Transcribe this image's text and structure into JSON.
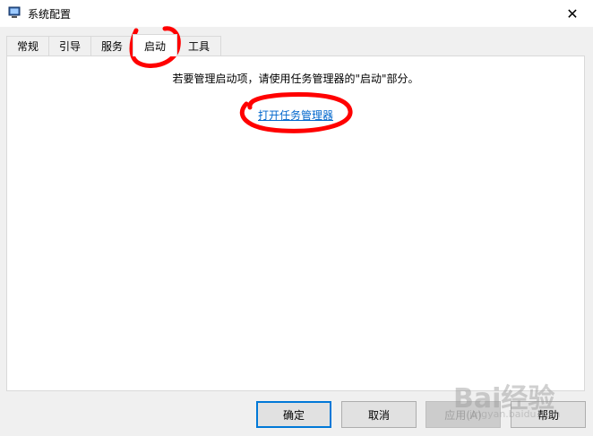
{
  "window": {
    "title": "系统配置",
    "close_glyph": "✕"
  },
  "tabs": [
    {
      "label": "常规",
      "active": false
    },
    {
      "label": "引导",
      "active": false
    },
    {
      "label": "服务",
      "active": false
    },
    {
      "label": "启动",
      "active": true
    },
    {
      "label": "工具",
      "active": false
    }
  ],
  "panel": {
    "message": "若要管理启动项，请使用任务管理器的\"启动\"部分。",
    "link": "打开任务管理器"
  },
  "buttons": {
    "ok": "确定",
    "cancel": "取消",
    "apply": "应用(A)",
    "help": "帮助"
  },
  "watermark": {
    "text": "Bai经验",
    "url": "jingyan.baidu.com"
  },
  "colors": {
    "link": "#0066cc",
    "annotation": "#ff0000",
    "default_button_border": "#0078d7"
  }
}
